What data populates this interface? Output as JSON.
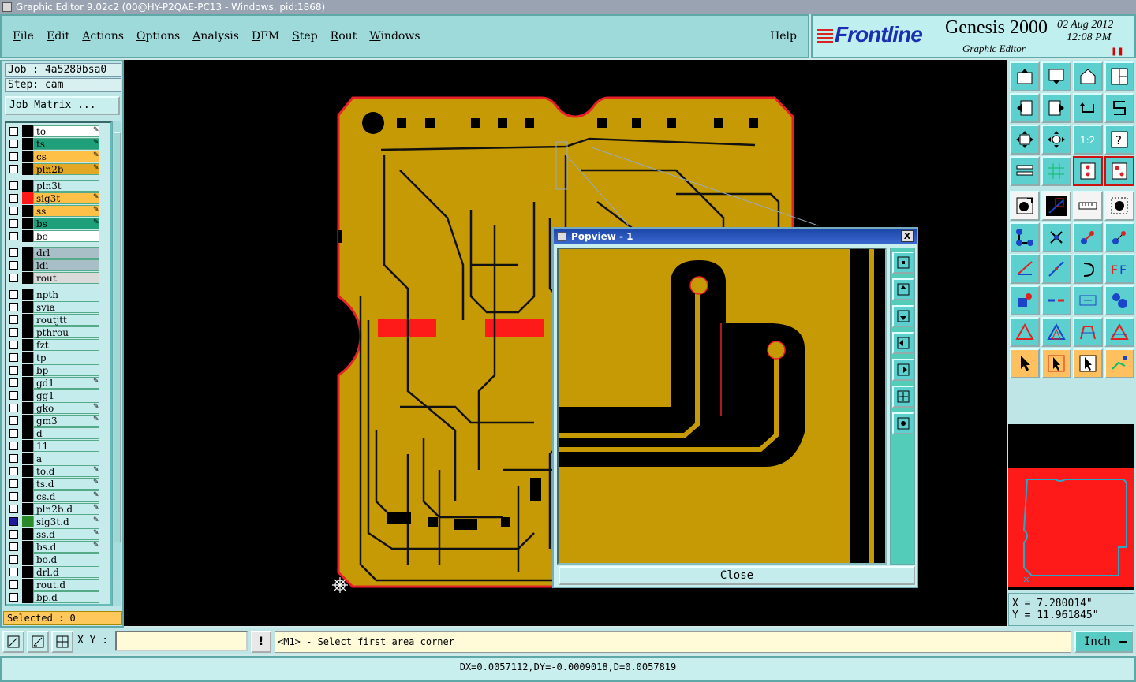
{
  "window": {
    "title": "Graphic Editor 9.02c2 (00@HY-P2QAE-PC13 - Windows, pid:1868)"
  },
  "menu": {
    "items": [
      "File",
      "Edit",
      "Actions",
      "Options",
      "Analysis",
      "DFM",
      "Step",
      "Rout",
      "Windows"
    ],
    "help": "Help"
  },
  "brand": {
    "logo": "Frontline",
    "product": "Genesis 2000",
    "date": "02 Aug 2012",
    "time": "12:08 PM",
    "subtitle": "Graphic Editor"
  },
  "job": {
    "job_line": "Job : 4a5280bsa0",
    "step_line": "Step: cam",
    "matrix_button": "Job Matrix ..."
  },
  "layers": [
    {
      "name": "to",
      "color": "#ffffff",
      "mark": true
    },
    {
      "name": "ts",
      "color": "#1fa07a",
      "mark": true
    },
    {
      "name": "cs",
      "color": "#ffc048",
      "mark": true
    },
    {
      "name": "pln2b",
      "color": "#e2a826",
      "mark": true
    },
    {
      "name": "pln3t",
      "color": "#c5ecec",
      "mark": false
    },
    {
      "name": "sig3t",
      "color": "#ffc048",
      "mark": true,
      "swatch": "#ff1a1a"
    },
    {
      "name": "ss",
      "color": "#ffc048",
      "mark": true
    },
    {
      "name": "bs",
      "color": "#1fa07a",
      "mark": true
    },
    {
      "name": "bo",
      "color": "#ffffff",
      "mark": false
    },
    {
      "name": "drl",
      "color": "#a9bfc8",
      "mark": false
    },
    {
      "name": "ldi",
      "color": "#a9bfc8",
      "mark": false
    },
    {
      "name": "rout",
      "color": "#dadada",
      "mark": false
    },
    {
      "name": "npth",
      "color": "#c5ecec",
      "mark": false
    },
    {
      "name": "svia",
      "color": "#c5ecec",
      "mark": false
    },
    {
      "name": "routjtt",
      "color": "#c5ecec",
      "mark": false
    },
    {
      "name": "pthrou",
      "color": "#c5ecec",
      "mark": false
    },
    {
      "name": "fzt",
      "color": "#c5ecec",
      "mark": false
    },
    {
      "name": "tp",
      "color": "#c5ecec",
      "mark": false
    },
    {
      "name": "bp",
      "color": "#c5ecec",
      "mark": false
    },
    {
      "name": "gd1",
      "color": "#c5ecec",
      "mark": true
    },
    {
      "name": "gg1",
      "color": "#c5ecec",
      "mark": false
    },
    {
      "name": "gko",
      "color": "#c5ecec",
      "mark": true
    },
    {
      "name": "gm3",
      "color": "#c5ecec",
      "mark": true
    },
    {
      "name": "d",
      "color": "#c5ecec",
      "mark": false
    },
    {
      "name": "11",
      "color": "#c5ecec",
      "mark": false
    },
    {
      "name": "a",
      "color": "#c5ecec",
      "mark": false
    },
    {
      "name": "to.d",
      "color": "#c5ecec",
      "mark": true
    },
    {
      "name": "ts.d",
      "color": "#c5ecec",
      "mark": true
    },
    {
      "name": "cs.d",
      "color": "#c5ecec",
      "mark": true
    },
    {
      "name": "pln2b.d",
      "color": "#c5ecec",
      "mark": true
    },
    {
      "name": "sig3t.d",
      "color": "#c5ecec",
      "mark": true,
      "swatch": "#2a8a2a",
      "selected": true
    },
    {
      "name": "ss.d",
      "color": "#c5ecec",
      "mark": true
    },
    {
      "name": "bs.d",
      "color": "#c5ecec",
      "mark": true
    },
    {
      "name": "bo.d",
      "color": "#c5ecec",
      "mark": false
    },
    {
      "name": "drl.d",
      "color": "#c5ecec",
      "mark": false
    },
    {
      "name": "rout.d",
      "color": "#c5ecec",
      "mark": false
    },
    {
      "name": "bp.d",
      "color": "#c5ecec",
      "mark": false
    }
  ],
  "selected_text": "Selected : 0",
  "popview": {
    "title": "Popview - 1",
    "close_label": "Close",
    "close_x": "X"
  },
  "coords": {
    "x": "X = 7.280014\"",
    "y": "Y = 11.961845\""
  },
  "bottom": {
    "xy_label": "X Y :",
    "xy_value": "",
    "warn": "!",
    "prompt": "<M1> - Select first area corner",
    "units": "Inch"
  },
  "status": "DX=0.0057112,DY=-0.0009018,D=0.0057819",
  "colors": {
    "board": "#c59a04",
    "outline": "#e8202a",
    "trace": "#111111",
    "panel": "#bfe6e6"
  }
}
